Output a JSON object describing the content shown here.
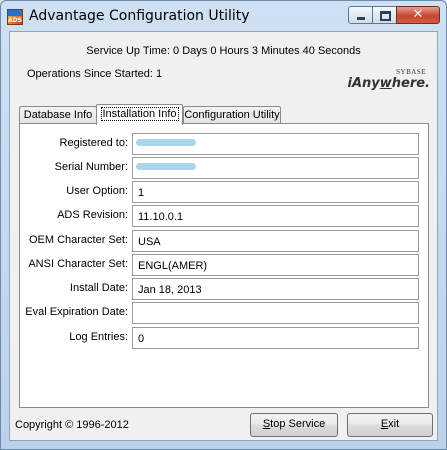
{
  "window": {
    "title": "Advantage Configuration Utility",
    "app_icon_text": "ADS"
  },
  "status": {
    "uptime": "Service Up Time: 0 Days 0 Hours 3 Minutes 40 Seconds",
    "operations": "Operations Since Started: 1"
  },
  "logo": {
    "small": "SYBASE",
    "big_prefix": "iAny",
    "big_underlined": "w",
    "big_suffix": "here."
  },
  "tabs": [
    {
      "label": "Database Info",
      "active": false
    },
    {
      "label": "Installation Info",
      "active": true
    },
    {
      "label": "Configuration Utility",
      "active": false
    }
  ],
  "fields": [
    {
      "label": "Registered to:",
      "value": "",
      "redacted": true
    },
    {
      "label": "Serial Number:",
      "value": "",
      "redacted": true
    },
    {
      "label": "User Option:",
      "value": "1"
    },
    {
      "label": "ADS Revision:",
      "value": "11.10.0.1"
    },
    {
      "label": "OEM Character Set:",
      "value": "USA"
    },
    {
      "label": "ANSI Character Set:",
      "value": "ENGL(AMER)"
    },
    {
      "label": "Install Date:",
      "value": "Jan 18, 2013"
    },
    {
      "label": "Eval Expiration Date:",
      "value": ""
    },
    {
      "label": "Log Entries:",
      "value": "0"
    }
  ],
  "footer": {
    "copyright": "Copyright © 1996-2012",
    "stop_service_mnemonic": "S",
    "stop_service_rest": "top Service",
    "exit_mnemonic": "E",
    "exit_rest": "xit"
  },
  "colors": {
    "redaction": "#a9d6ea",
    "close_button": "#c6452f"
  }
}
